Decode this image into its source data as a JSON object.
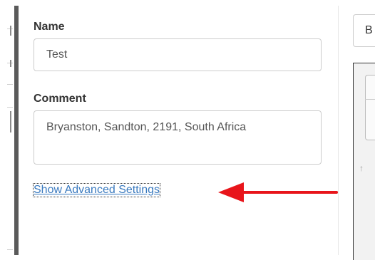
{
  "form": {
    "name_label": "Name",
    "name_value": "Test",
    "comment_label": "Comment",
    "comment_value": "Bryanston, Sandton, 2191, South Africa",
    "advanced_link": "Show Advanced Settings"
  },
  "right_panel": {
    "button_label": "B",
    "map_glyph": "↑"
  },
  "colors": {
    "link": "#3a7abf",
    "arrow": "#e8151b",
    "dialog_border": "#5a5a5a"
  },
  "icons": {
    "arrow": "red-left-arrow"
  }
}
